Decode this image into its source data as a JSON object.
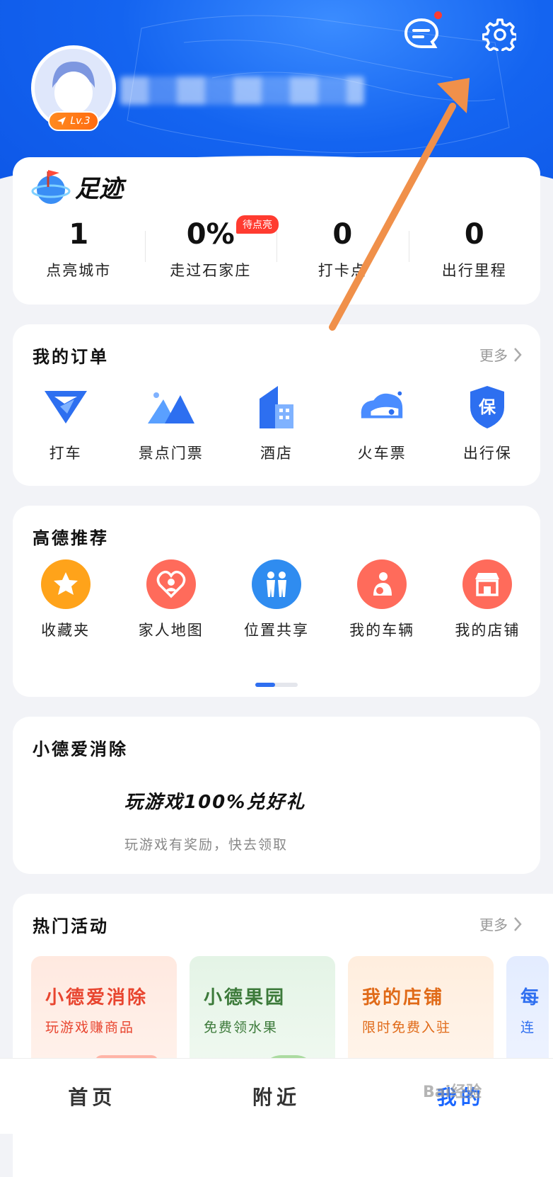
{
  "header": {
    "level": "Lv.3",
    "accent": "#1464f0"
  },
  "footprint": {
    "title": "足迹",
    "stats": [
      {
        "value": "1",
        "label": "点亮城市"
      },
      {
        "value": "0%",
        "label": "走过石家庄",
        "badge": "待点亮"
      },
      {
        "value": "0",
        "label": "打卡点"
      },
      {
        "value": "0",
        "label": "出行里程"
      }
    ]
  },
  "orders": {
    "title": "我的订单",
    "more": "更多",
    "items": [
      {
        "label": "打车",
        "icon": "taxi-icon"
      },
      {
        "label": "景点门票",
        "icon": "mountain-icon"
      },
      {
        "label": "酒店",
        "icon": "hotel-icon"
      },
      {
        "label": "火车票",
        "icon": "train-icon"
      },
      {
        "label": "出行保",
        "icon": "shield-icon"
      }
    ]
  },
  "recommend": {
    "title": "高德推荐",
    "items": [
      {
        "label": "收藏夹",
        "icon": "star-icon",
        "color": "#ffa31a"
      },
      {
        "label": "家人地图",
        "icon": "heart-icon",
        "color": "#ff6b5b"
      },
      {
        "label": "位置共享",
        "icon": "people-icon",
        "color": "#2f8cf0"
      },
      {
        "label": "我的车辆",
        "icon": "driver-icon",
        "color": "#ff6b5b"
      },
      {
        "label": "我的店铺",
        "icon": "shop-icon",
        "color": "#ff6b5b"
      }
    ]
  },
  "game": {
    "title": "小德爱消除",
    "headline": "玩游戏100%兑好礼",
    "subtitle": "玩游戏有奖励，快去领取"
  },
  "events": {
    "title": "热门活动",
    "more": "更多",
    "cards": [
      {
        "title": "小德爱消除",
        "subtitle": "玩游戏赚商品",
        "color": "#e8452f"
      },
      {
        "title": "小德果园",
        "subtitle": "免费领水果",
        "color": "#3c7a3a"
      },
      {
        "title": "我的店铺",
        "subtitle": "限时免费入驻",
        "color": "#e06a18"
      },
      {
        "title": "每",
        "subtitle": "连",
        "color": "#2f6ff0"
      }
    ]
  },
  "tabs": [
    {
      "label": "首页"
    },
    {
      "label": "附近"
    },
    {
      "label": "我的"
    }
  ],
  "watermark": "Bai经验"
}
